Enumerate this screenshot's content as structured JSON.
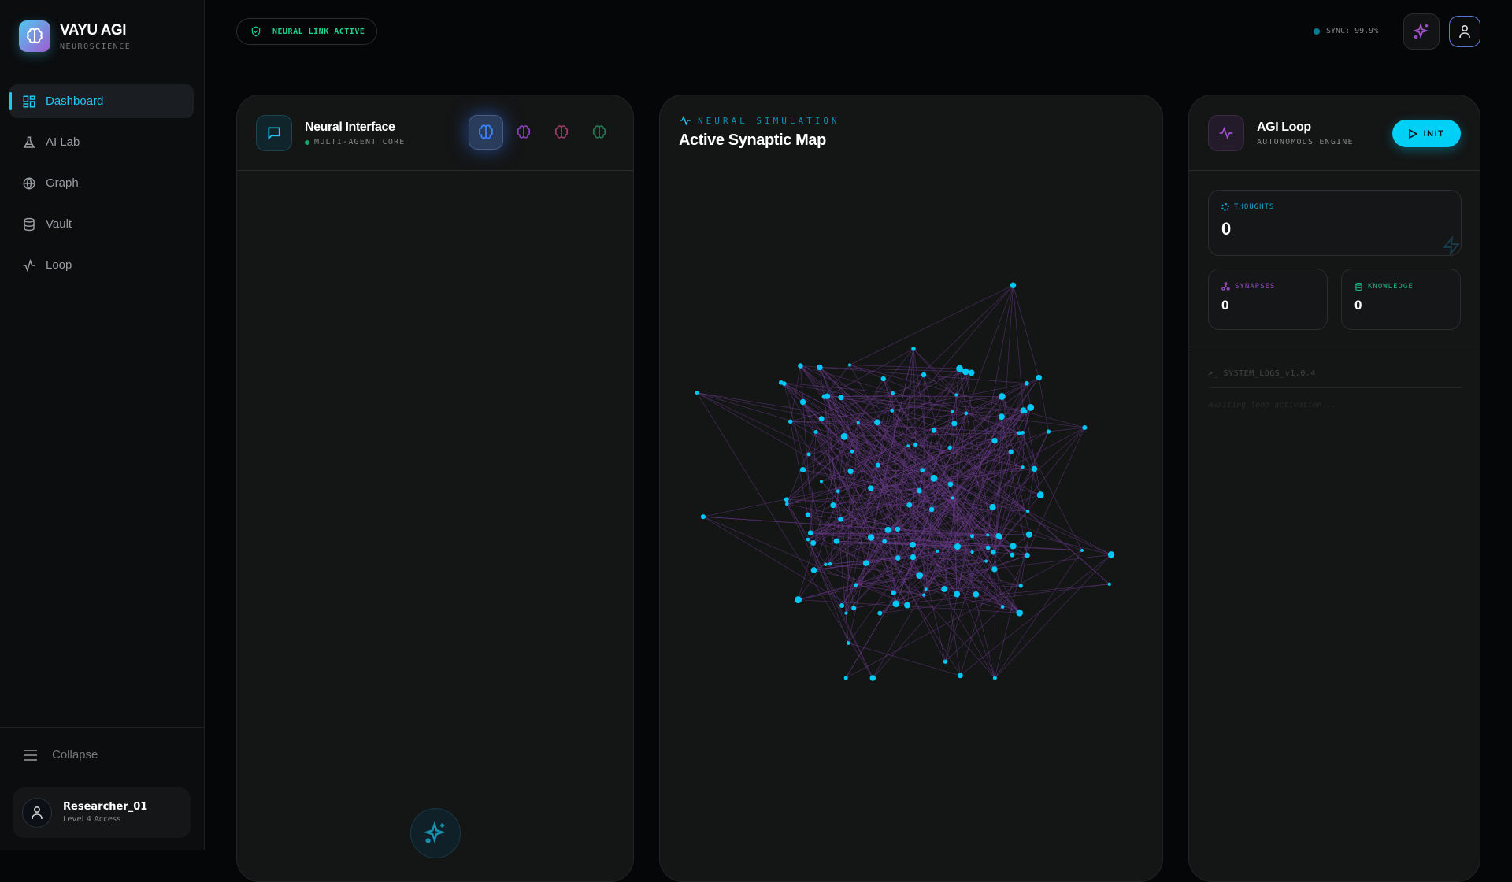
{
  "brand": {
    "name": "VAYU AGI",
    "subtitle": "NEUROSCIENCE"
  },
  "sidebar": {
    "items": [
      {
        "label": "Dashboard",
        "icon": "dashboard-icon",
        "active": true
      },
      {
        "label": "AI Lab",
        "icon": "flask-icon"
      },
      {
        "label": "Graph",
        "icon": "globe-icon"
      },
      {
        "label": "Vault",
        "icon": "database-icon"
      },
      {
        "label": "Loop",
        "icon": "activity-icon"
      }
    ],
    "collapse_label": "Collapse"
  },
  "user": {
    "name": "Researcher_01",
    "level": "Level 4 Access"
  },
  "header": {
    "status_badge": "NEURAL LINK ACTIVE",
    "sync": "SYNC: 99.9%"
  },
  "neural_interface": {
    "title": "Neural Interface",
    "subtitle": "MULTI-AGENT CORE",
    "modes": [
      {
        "name": "blue",
        "color": "#3b82f6"
      },
      {
        "name": "purple",
        "color": "#8b3fc0"
      },
      {
        "name": "pink",
        "color": "#a03a6a"
      },
      {
        "name": "green",
        "color": "#1f7a52"
      }
    ]
  },
  "simulation": {
    "eyebrow": "NEURAL SIMULATION",
    "title": "Active Synaptic Map",
    "node_color": "#00c8f5",
    "edge_color": "#6a3a8a"
  },
  "agi_loop": {
    "title": "AGI Loop",
    "subtitle": "AUTONOMOUS ENGINE",
    "init_label": "INIT",
    "stats": {
      "thoughts": {
        "label": "THOUGHTS",
        "value": "0"
      },
      "synapses": {
        "label": "SYNAPSES",
        "value": "0"
      },
      "knowledge": {
        "label": "KNOWLEDGE",
        "value": "0"
      }
    },
    "logs_title": ">_ SYSTEM_LOGS_v1.0.4",
    "logs_empty": "Awaiting loop activation..."
  },
  "colors": {
    "accent": "#1ec8f0",
    "success": "#1fd08f",
    "purple": "#a050d0"
  }
}
